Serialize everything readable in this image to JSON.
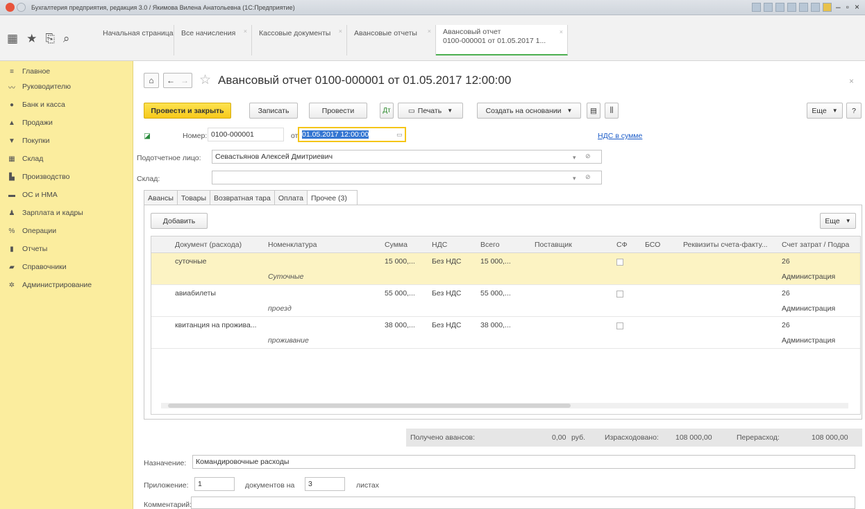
{
  "window": {
    "title": "Бухгалтерия предприятия, редакция 3.0 / Якимова Вилена Анатольевна (1С:Предприятие)"
  },
  "nav_tabs": [
    {
      "label": "Начальная страница"
    },
    {
      "label": "Все начисления"
    },
    {
      "label": "Кассовые документы"
    },
    {
      "label": "Авансовые отчеты"
    },
    {
      "label_line1": "Авансовый отчет",
      "label_line2": "0100-000001 от 01.05.2017 1..."
    }
  ],
  "sidebar": {
    "items": [
      {
        "label": "Главное",
        "icon": "menu-icon"
      },
      {
        "label": "Руководителю",
        "icon": "chart-line-icon"
      },
      {
        "label": "Банк и касса",
        "icon": "coin-icon"
      },
      {
        "label": "Продажи",
        "icon": "bag-icon"
      },
      {
        "label": "Покупки",
        "icon": "cart-icon"
      },
      {
        "label": "Склад",
        "icon": "warehouse-icon"
      },
      {
        "label": "Производство",
        "icon": "factory-icon"
      },
      {
        "label": "ОС и НМА",
        "icon": "truck-icon"
      },
      {
        "label": "Зарплата и кадры",
        "icon": "person-icon"
      },
      {
        "label": "Операции",
        "icon": "operations-icon"
      },
      {
        "label": "Отчеты",
        "icon": "report-icon"
      },
      {
        "label": "Справочники",
        "icon": "book-icon"
      },
      {
        "label": "Администрирование",
        "icon": "gear-icon"
      }
    ]
  },
  "document": {
    "title": "Авансовый отчет 0100-000001 от 01.05.2017 12:00:00",
    "toolbar": {
      "post_close": "Провести и закрыть",
      "save": "Записать",
      "post": "Провести",
      "print": "Печать",
      "create_based": "Создать на основании",
      "more": "Еще",
      "help": "?"
    },
    "number_label": "Номер:",
    "number_value": "0100-000001",
    "date_label": "от:",
    "date_value": "01.05.2017 12:00:00",
    "vat_link": "НДС в сумме",
    "person_label": "Подотчетное лицо:",
    "person_value": "Севастьянов Алексей Дмитриевич",
    "warehouse_label": "Склад:",
    "warehouse_value": ""
  },
  "inner_tabs": [
    {
      "label": "Авансы"
    },
    {
      "label": "Товары"
    },
    {
      "label": "Возвратная тара"
    },
    {
      "label": "Оплата"
    },
    {
      "label": "Прочее (3)"
    }
  ],
  "panel": {
    "add_button": "Добавить",
    "more_button": "Еще"
  },
  "table": {
    "columns": [
      "Документ (расхода)",
      "Номенклатура",
      "Сумма",
      "НДС",
      "Всего",
      "Поставщик",
      "СФ",
      "БСО",
      "Реквизиты счета-факту...",
      "Счет затрат / Подра"
    ],
    "rows": [
      {
        "document": "суточные",
        "nomenclature": "Суточные",
        "sum": "15 000,...",
        "vat": "Без НДС",
        "total": "15 000,...",
        "account": "26",
        "division": "Администрация"
      },
      {
        "document": "авиабилеты",
        "nomenclature": "проезд",
        "sum": "55 000,...",
        "vat": "Без НДС",
        "total": "55 000,...",
        "account": "26",
        "division": "Администрация"
      },
      {
        "document": "квитанция на прожива...",
        "nomenclature": "проживание",
        "sum": "38 000,...",
        "vat": "Без НДС",
        "total": "38 000,...",
        "account": "26",
        "division": "Администрация"
      }
    ]
  },
  "totals": {
    "received_label": "Получено авансов:",
    "received_value": "0,00",
    "currency": "руб.",
    "spent_label": "Израсходовано:",
    "spent_value": "108 000,00",
    "overspent_label": "Перерасход:",
    "overspent_value": "108 000,00"
  },
  "footer": {
    "purpose_label": "Назначение:",
    "purpose_value": "Командировочные расходы",
    "attachment_label": "Приложение:",
    "attachment_count": "1",
    "docs_on_label": "документов на",
    "pages_count": "3",
    "pages_label": "листах",
    "comment_label": "Комментарий:",
    "comment_value": ""
  },
  "colors": {
    "sidebar_bg": "#fbed9e",
    "primary_button": "#f7c91b",
    "selected_row": "#fcf3c3",
    "link": "#1c5cc8",
    "active_tab_underline": "#4caf50"
  }
}
